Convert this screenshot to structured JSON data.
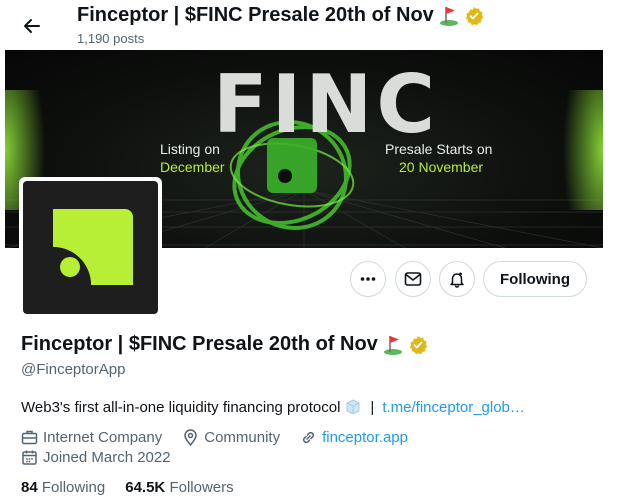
{
  "header": {
    "title": "Finceptor | $FINC Presale 20th of Nov",
    "posts_count": "1,190 posts"
  },
  "banner": {
    "logo_text": "FINC",
    "left_line1": "Listing on",
    "left_line2": "December",
    "right_line1": "Presale Starts on",
    "right_line2": "20 November"
  },
  "profile": {
    "name": "Finceptor | $FINC Presale 20th of Nov",
    "handle": "@FinceptorApp",
    "bio_text": "Web3's first all-in-one liquidity financing protocol",
    "bio_separator": "|",
    "bio_link": "t.me/finceptor_glob…",
    "category": "Internet Company",
    "location": "Community",
    "website": "finceptor.app",
    "joined": "Joined March 2022",
    "following_count": "84",
    "following_label": "Following",
    "followers_count": "64.5K",
    "followers_label": "Followers"
  },
  "actions": {
    "follow_label": "Following"
  },
  "colors": {
    "accent": "#1d9bf0",
    "brand_green": "#b6ef36",
    "verified_gold": "#e2b719"
  },
  "icons": [
    "back-arrow-icon",
    "golf-flag-emoji",
    "verified-badge-icon",
    "more-icon",
    "message-icon",
    "notification-bell-icon",
    "ice-cube-emoji",
    "briefcase-icon",
    "location-icon",
    "link-icon",
    "calendar-icon"
  ]
}
